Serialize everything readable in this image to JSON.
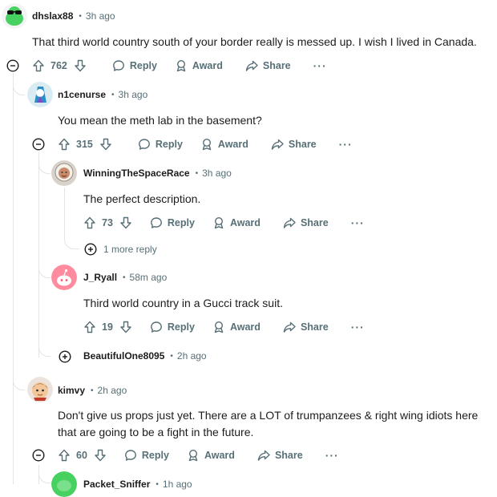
{
  "comments": [
    {
      "id": "c1",
      "user": "dhslax88",
      "time": "3h ago",
      "text": "That third world country south of your border really is messed up. I wish I lived in Canada.",
      "score": "762"
    },
    {
      "id": "c2",
      "user": "n1cenurse",
      "time": "3h ago",
      "text": "You mean the meth lab in the basement?",
      "score": "315"
    },
    {
      "id": "c3",
      "user": "WinningTheSpaceRace",
      "time": "3h ago",
      "text": "The perfect description.",
      "score": "73"
    },
    {
      "id": "c4",
      "user": "J_Ryall",
      "time": "58m ago",
      "text": "Third world country in a Gucci track suit.",
      "score": "19"
    },
    {
      "id": "c5",
      "user": "BeautifulOne8095",
      "time": "2h ago"
    },
    {
      "id": "c6",
      "user": "kimvy",
      "time": "2h ago",
      "text": "Don't give us props just yet. There are a LOT of trumpanzees & right wing idiots here that are going to be a fight in the future.",
      "score": "60"
    },
    {
      "id": "c7",
      "user": "Packet_Sniffer",
      "time": "1h ago"
    }
  ],
  "labels": {
    "reply": "Reply",
    "award": "Award",
    "share": "Share",
    "more": "···"
  },
  "more_replies": "1 more reply",
  "dot": "•",
  "icons": {
    "upvote": "arrow-up-icon",
    "downvote": "arrow-down-icon",
    "reply": "speech-bubble-icon",
    "award": "award-icon",
    "share": "share-arrow-icon",
    "collapse": "minus-circle-icon",
    "expand": "plus-circle-icon"
  }
}
